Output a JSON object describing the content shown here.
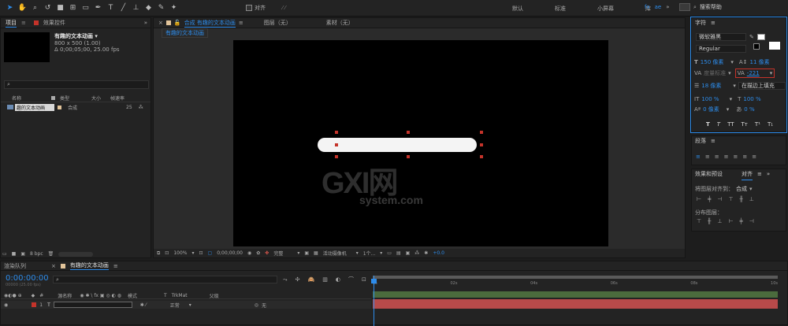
{
  "toolbar": {
    "snap_label": "对齐",
    "workspaces": [
      "默认",
      "标准",
      "小屏幕",
      "库"
    ],
    "search_placeholder": "搜索帮助"
  },
  "project_panel": {
    "tab_label": "项目",
    "effects_tab_label": "效果控件",
    "comp_name": "有趣的文本动画 ▾",
    "comp_info1": "800 x 500 (1.00)",
    "comp_info2": "Δ 0;00;05;00, 25.00 fps",
    "columns": [
      "名称",
      "类型",
      "大小",
      "帧速率"
    ],
    "items": [
      {
        "name": "趣的文本动画",
        "type": "合成",
        "fps": "25"
      }
    ],
    "bpc": "8 bpc"
  },
  "composition_panel": {
    "tab_label": "合成 有趣的文本动画",
    "layer_tab": "图层（无）",
    "footage_tab": "素材（无）",
    "breadcrumb": "有趣的文本动画",
    "zoom": "100%",
    "timecode": "0;00;00;00",
    "resolution": "完整",
    "camera": "活动摄像机",
    "views": "1个...",
    "exposure": "+0.0"
  },
  "character_panel": {
    "title": "字符",
    "font": "微软雅黑",
    "style": "Regular",
    "font_size": "150 像素",
    "leading": "11 像素",
    "kerning": "度量标准",
    "tracking": "-221",
    "stroke_width": "18 像素",
    "stroke_type": "在描边上填充",
    "vert_scale": "100 %",
    "horiz_scale": "100 %",
    "baseline": "0 像素",
    "tsume": "0 %",
    "style_buttons": [
      "T",
      "T",
      "TT",
      "Tт",
      "T¹",
      "T₁"
    ]
  },
  "paragraph_panel": {
    "title": "段落"
  },
  "align_panel": {
    "effects_tab": "效果和预设",
    "align_tab": "对齐",
    "align_to_label": "将图层对齐到：",
    "align_to_value": "合成",
    "distribute_label": "分布图层："
  },
  "timeline": {
    "render_queue_tab": "渲染队列",
    "comp_tab": "有趣的文本动画",
    "timecode": "0:00:00:00",
    "timecode_sub": "00000 (25.00 fps)",
    "ruler_ticks": [
      "0s",
      "02s",
      "04s",
      "06s",
      "08s",
      "10s"
    ],
    "columns": [
      "源名称",
      "模式",
      "T",
      "TrkMat",
      "父级"
    ],
    "layer": {
      "index": "1",
      "name": "",
      "mode": "正常",
      "parent": "无"
    }
  },
  "colors": {
    "accent": "#2d8ceb",
    "layer_bar": "#b84a4a",
    "label_red": "#c4332a"
  }
}
